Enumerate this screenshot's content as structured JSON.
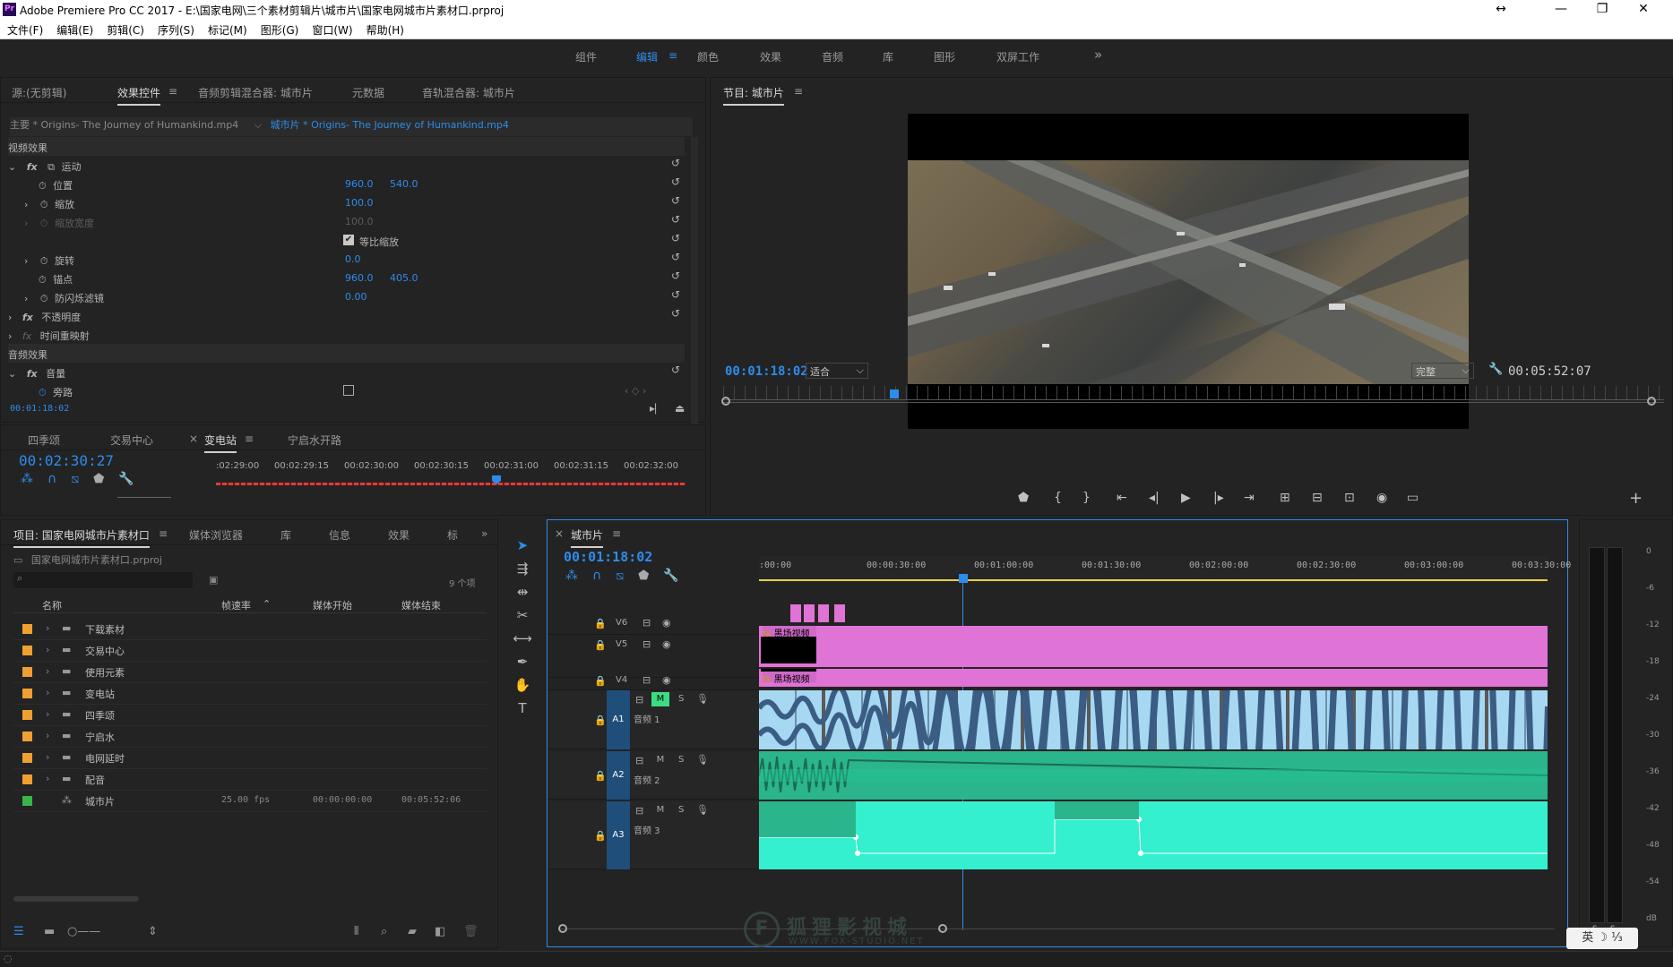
{
  "app": {
    "title": "Adobe Premiere Pro CC 2017 - E:\\国家电网\\三个素材剪辑片\\城市片\\国家电网城市片素材口.prproj",
    "logo": "Pr"
  },
  "window_controls": {
    "resize": "↔",
    "minimize": "—",
    "restore": "❐",
    "close": "✕"
  },
  "menu": [
    "文件(F)",
    "编辑(E)",
    "剪辑(C)",
    "序列(S)",
    "标记(M)",
    "图形(G)",
    "窗口(W)",
    "帮助(H)"
  ],
  "workspaces": {
    "items": [
      "组件",
      "编辑",
      "颜色",
      "效果",
      "音频",
      "库",
      "图形",
      "双屏工作"
    ],
    "active": "编辑",
    "more": "»",
    "menu_icon": "≡"
  },
  "effect_panel": {
    "tabs": [
      "源:(无剪辑)",
      "效果控件",
      "音频剪辑混合器: 城市片",
      "元数据",
      "音轨混合器: 城市片"
    ],
    "menu_icon": "≡",
    "master_label": "主要 * Origins- The Journey of Humankind.mp4",
    "sequence_label": "城市片 * Origins- The Journey of Humankind.mp4",
    "video_effects": "视频效果",
    "motion": "运动",
    "position": {
      "label": "位置",
      "x": "960.0",
      "y": "540.0"
    },
    "scale": {
      "label": "缩放",
      "value": "100.0"
    },
    "scale_width": {
      "label": "缩放宽度",
      "value": "100.0"
    },
    "uniform_scale": "等比缩放",
    "rotation": {
      "label": "旋转",
      "value": "0.0"
    },
    "anchor": {
      "label": "锚点",
      "x": "960.0",
      "y": "405.0"
    },
    "anti_flicker": {
      "label": "防闪烁滤镜",
      "value": "0.00"
    },
    "opacity": "不透明度",
    "time_remap": "时间重映射",
    "audio_effects": "音频效果",
    "volume": "音量",
    "bypass": "旁路",
    "timecode": "00:01:18:02"
  },
  "mini_timeline": {
    "tabs": [
      "四季颂",
      "交易中心",
      "变电站",
      "宁启水开路"
    ],
    "active": "变电站",
    "timecode": "00:02:30:27",
    "ticks": [
      ":02:29:00",
      "00:02:29:15",
      "00:02:30:00",
      "00:02:30:15",
      "00:02:31:00",
      "00:02:31:15",
      "00:02:32:00"
    ]
  },
  "program": {
    "title": "节目: 城市片",
    "menu_icon": "≡",
    "timecode": "00:01:18:02",
    "fit": "适合",
    "quality": "完整",
    "duration": "00:05:52:07",
    "transport": [
      "⬟",
      "{",
      "}",
      "⇤",
      "◂|",
      "▶",
      "|▸",
      "⇥",
      "⊞",
      "⊟",
      "⊡",
      "◉",
      "▭"
    ],
    "add": "+"
  },
  "project": {
    "tabs": [
      "项目: 国家电网城市片素材口",
      "媒体浏览器",
      "库",
      "信息",
      "效果",
      "标"
    ],
    "file": "国家电网城市片素材口.prproj",
    "count": "9 个项",
    "columns": [
      "名称",
      "帧速率",
      "媒体开始",
      "媒体结束"
    ],
    "items": [
      {
        "name": "下载素材",
        "color": "#f0a030"
      },
      {
        "name": "交易中心",
        "color": "#f0a030"
      },
      {
        "name": "使用元素",
        "color": "#f0a030"
      },
      {
        "name": "变电站",
        "color": "#f0a030"
      },
      {
        "name": "四季颂",
        "color": "#f0a030"
      },
      {
        "name": "宁启水",
        "color": "#f0a030"
      },
      {
        "name": "电网延时",
        "color": "#f0a030"
      },
      {
        "name": "配音",
        "color": "#f0a030"
      }
    ],
    "sequence": {
      "name": "城市片",
      "fps": "25.00 fps",
      "start": "00:00:00:00",
      "end": "00:05:52:06",
      "color": "#3ab54a"
    }
  },
  "timeline": {
    "title": "城市片",
    "menu_icon": "≡",
    "timecode": "00:01:18:02",
    "ruler": [
      ":00:00",
      "00:00:30:00",
      "00:01:00:00",
      "00:01:30:00",
      "00:02:00:00",
      "00:02:30:00",
      "00:03:00:00",
      "00:03:30:00"
    ],
    "video_tracks": [
      "V6",
      "V5",
      "V4"
    ],
    "audio_tracks": [
      {
        "id": "A1",
        "name": "音频 1"
      },
      {
        "id": "A2",
        "name": "音频 2"
      },
      {
        "id": "A3",
        "name": "音频 3"
      }
    ],
    "clip_label": "黑场视频",
    "mute": "M",
    "solo": "S"
  },
  "meter": {
    "scale": [
      "0",
      "-6",
      "-12",
      "-18",
      "-24",
      "-30",
      "-36",
      "-42",
      "-48",
      "-54",
      "dB"
    ],
    "solo": [
      "S",
      "S"
    ]
  },
  "watermark": {
    "title": "狐狸影视城",
    "url": "WWW.FOX-STUDIO.NET"
  },
  "ime": "英 ☽ ⅓",
  "colors": {
    "accent": "#2d8ceb",
    "pink_clip": "#e073d6",
    "audio_blue": "#a6d8f2",
    "audio_green": "#2bb58c",
    "audio_cyan": "#34f0cf"
  }
}
